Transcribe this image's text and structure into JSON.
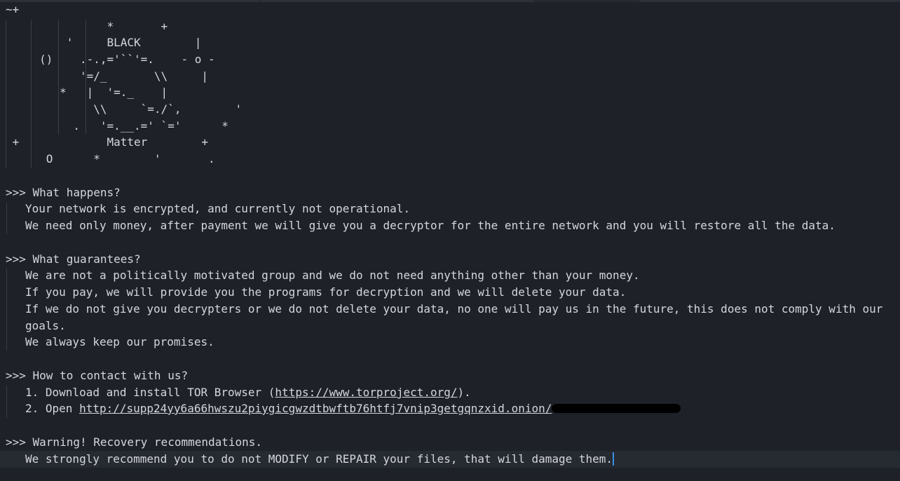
{
  "ascii_art": [
    "~+",
    "               *       +",
    "         '     BLACK        |",
    "     ()    .-.,='``'=.    - o -",
    "           '=/_       \\\\     |",
    "        *   |  '=._    |",
    "             \\\\     `=./`,        '",
    "          .   '=.__.=' `='      *",
    " +             Matter        +",
    "      O      *        '       ."
  ],
  "sections": [
    {
      "heading": ">>> What happens?",
      "lines": [
        "Your network is encrypted, and currently not operational.",
        "We need only money, after payment we will give you a decryptor for the entire network and you will restore all the data."
      ]
    },
    {
      "heading": ">>> What guarantees?",
      "lines": [
        "We are not a politically motivated group and we do not need anything other than your money.",
        "If you pay, we will provide you the programs for decryption and we will delete your data.",
        "If we do not give you decrypters or we do not delete your data, no one will pay us in the future, this does not comply with our",
        "goals.",
        "We always keep our promises."
      ]
    },
    {
      "heading": ">>> How to contact with us?",
      "step1_prefix": "1. Download and install TOR Browser (",
      "step1_link": "https://www.torproject.org/",
      "step1_suffix": ").",
      "step2_prefix": "2. Open ",
      "step2_link": "http://supp24yy6a66hwszu2piygicgwzdtbwftb76htfj7vnip3getgqnzxid.onion/"
    },
    {
      "heading": ">>> Warning! Recovery recommendations.",
      "lines": [
        "We strongly recommend you to do not MODIFY or REPAIR your files, that will damage them."
      ]
    }
  ],
  "colors": {
    "background": "#1e2127",
    "text": "#d4d7dc",
    "caret": "#3b8eea",
    "redaction": "#000000"
  }
}
